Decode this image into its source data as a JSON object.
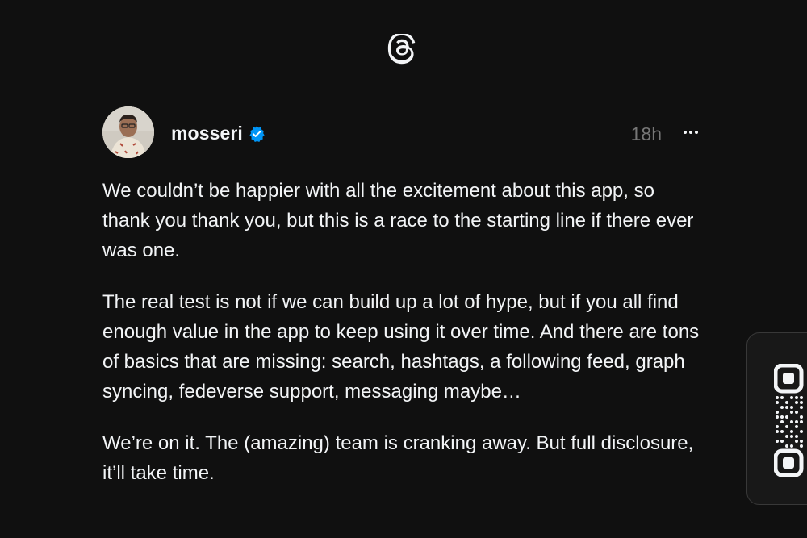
{
  "app": {
    "logo_icon": "threads-logo-icon"
  },
  "post": {
    "author": {
      "username": "mosseri",
      "verified": true,
      "avatar_icon": "avatar-photo"
    },
    "timestamp": "18h",
    "more_icon": "more-horizontal-icon",
    "paragraphs": [
      "We couldn’t be happier with all the excitement about this app, so thank you thank you, but this is a race to the starting line if there ever was one.",
      "The real test is not if we can build up a lot of hype, but if you all find enough value in the app to keep using it over time. And there are tons of basics that are missing: search, hashtags, a following feed, graph syncing, fedeverse support, messaging maybe…",
      "We’re on it. The (amazing) team is cranking away. But full disclosure, it’ll take time."
    ]
  },
  "qr_card": {
    "icon": "qr-code-icon"
  },
  "colors": {
    "background": "#101010",
    "text": "#f3f5f7",
    "muted": "#777777",
    "verified": "#0095f6"
  }
}
